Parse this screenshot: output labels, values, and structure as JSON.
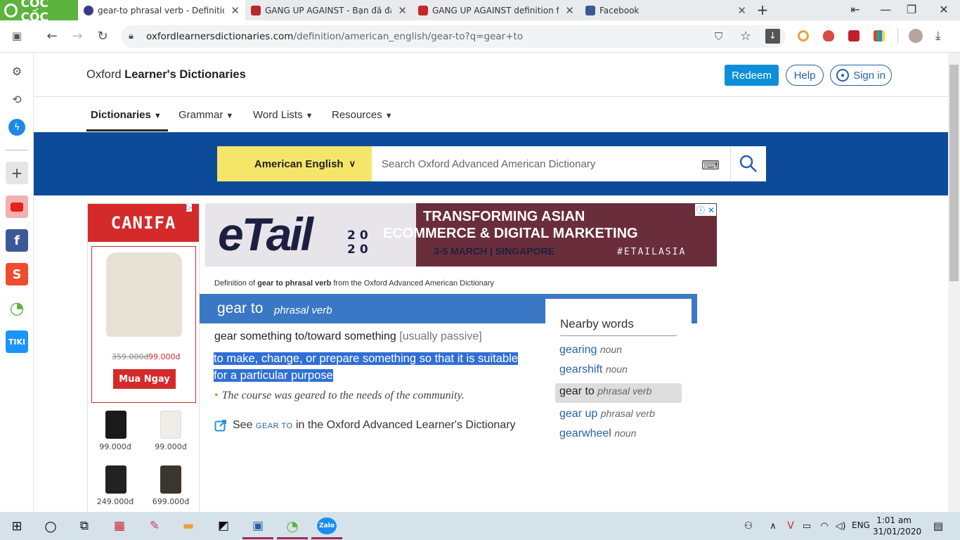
{
  "browser": {
    "logo": "CỐC CỐC",
    "tabs": [
      {
        "title": "gear-to phrasal verb - Definition, p",
        "active": true,
        "favicon_color": "#3a3a8a"
      },
      {
        "title": "GANG UP AGAINST - Bạn đã đánh",
        "active": false,
        "favicon_color": "#b52a2a"
      },
      {
        "title": "GANG UP AGAINST definition from",
        "active": false,
        "favicon_color": "#c62828"
      },
      {
        "title": "Facebook",
        "active": false,
        "favicon_color": "#3b5998"
      }
    ],
    "new_tab": "+",
    "url_host": "oxfordlearnersdictionaries.com",
    "url_path": "/definition/american_english/gear-to?q=gear+to"
  },
  "sidebar": {
    "items": [
      {
        "icon": "panel-icon"
      },
      {
        "icon": "gear-icon"
      },
      {
        "icon": "history-icon"
      },
      {
        "icon": "messenger-icon"
      },
      {
        "icon": "add-icon"
      },
      {
        "icon": "youtube-icon"
      },
      {
        "icon": "facebook-icon"
      },
      {
        "icon": "shopee-icon"
      },
      {
        "icon": "coccoc-icon"
      },
      {
        "icon": "tiki-icon"
      }
    ]
  },
  "site": {
    "brand_prefix": "Oxford ",
    "brand_bold": "Learner's Dictionaries",
    "redeem": "Redeem",
    "help": "Help",
    "sign_in": "Sign in",
    "menu": [
      "Dictionaries",
      "Grammar",
      "Word Lists",
      "Resources"
    ],
    "dictionary_selector": "American English",
    "search_placeholder": "Search Oxford Advanced American Dictionary"
  },
  "ad_left": {
    "brand": "CANIFA",
    "old_price": "359.000đ",
    "new_price": "99.000đ",
    "buy": "Mua Ngay",
    "thumbs": [
      {
        "price": "99.000đ",
        "color": "#1a1a1a"
      },
      {
        "price": "99.000đ",
        "color": "#f0ede8"
      },
      {
        "price": "249.000đ",
        "color": "#222"
      },
      {
        "price": "699.000đ",
        "color": "#3b3530"
      }
    ]
  },
  "banner": {
    "logo": "eTail",
    "year_top": "20",
    "year_bottom": "20",
    "line1": "TRANSFORMING ASIAN",
    "line2": "ECOMMERCE & DIGITAL MARKETING",
    "line3": "3-5 MARCH |  SINGAPORE",
    "hashtag": "#ETAILASIA"
  },
  "entry": {
    "source_prefix": "Definition of ",
    "source_bold": "gear to phrasal verb",
    "source_suffix": " from the Oxford Advanced American Dictionary",
    "headword": "gear to",
    "pos": "phrasal verb",
    "sense_pattern": "gear something to/toward something",
    "sense_grammar": "[usually passive]",
    "definition": "to make, change, or prepare something so that it is suitable for a particular purpose",
    "example": "The course was geared to the needs of the community.",
    "see_prefix": "See ",
    "see_word": "GEAR TO",
    "see_suffix": " in the Oxford Advanced Learner's Dictionary"
  },
  "nearby": {
    "title": "Nearby words",
    "items": [
      {
        "word": "gearing",
        "pos": "noun"
      },
      {
        "word": "gearshift",
        "pos": "noun"
      },
      {
        "word": "gear to",
        "pos": "phrasal verb"
      },
      {
        "word": "gear up",
        "pos": "phrasal verb"
      },
      {
        "word": "gearwheel",
        "pos": "noun"
      }
    ]
  },
  "taskbar": {
    "lang": "ENG",
    "time": "1:01 am",
    "date": "31/01/2020"
  }
}
